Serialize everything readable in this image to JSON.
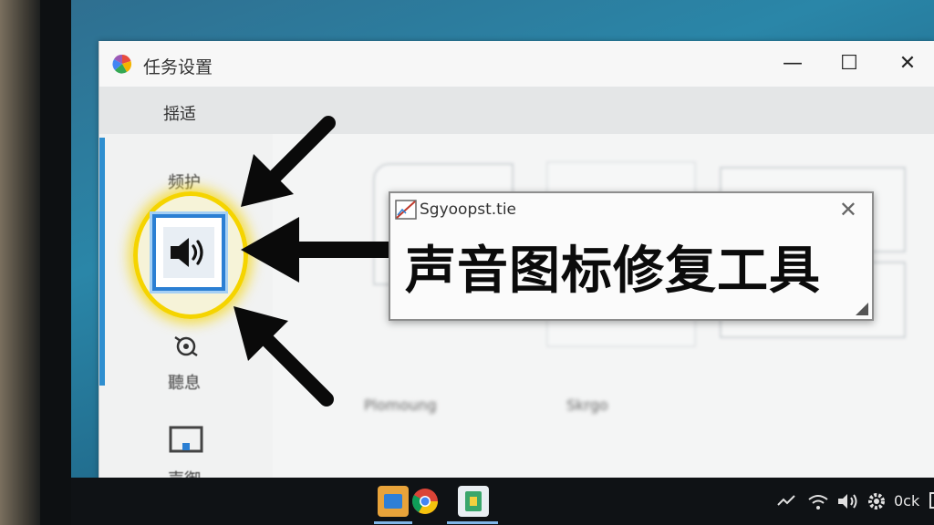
{
  "window": {
    "title": "任务设置",
    "menu_label": "揺适",
    "controls": {
      "minimize": "—",
      "maximize": "☐",
      "close": "✕"
    }
  },
  "sidebar": {
    "items": [
      {
        "label": "频护"
      },
      {
        "label": "聽息"
      },
      {
        "label": "声御"
      }
    ]
  },
  "content": {
    "cards": [
      {
        "label": "Plomoung"
      },
      {
        "label": "Skrgo"
      }
    ]
  },
  "overlay": {
    "title": "Sgyoopst.tie",
    "close": "✕",
    "headline": "声音图标修复工具"
  },
  "taskbar": {
    "tray_label": "0ck"
  },
  "colors": {
    "highlight": "#f5d400",
    "accent": "#2b7fd3",
    "arrow": "#0a0a0a"
  }
}
